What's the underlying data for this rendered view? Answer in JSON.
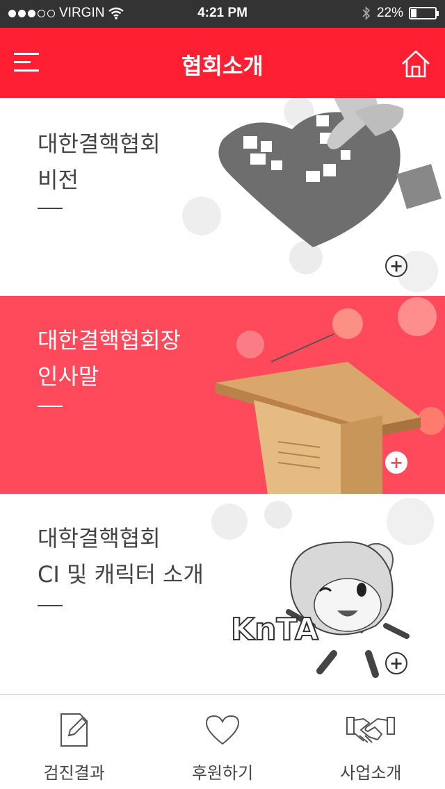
{
  "status_bar": {
    "carrier": "VIRGIN",
    "time": "4:21 PM",
    "battery": "22%",
    "battery_level": 0.22
  },
  "header": {
    "title": "협회소개",
    "menu_icon": "hamburger-menu-icon",
    "home_icon": "home-icon"
  },
  "cards": [
    {
      "line1": "대한결핵협회",
      "line2": "비전",
      "image": "heart-puzzle-image"
    },
    {
      "line1": "대한결핵협회장",
      "line2": "인사말",
      "image": "podium-image"
    },
    {
      "line1": "대학결핵협회",
      "line2": "CI 및 캐릭터 소개",
      "image": "knta-character-image",
      "logo_text": "KnTA"
    }
  ],
  "tabs": [
    {
      "label": "검진결과",
      "icon": "edit-document-icon"
    },
    {
      "label": "후원하기",
      "icon": "heart-icon"
    },
    {
      "label": "사업소개",
      "icon": "handshake-icon"
    }
  ],
  "colors": {
    "brand_red": "#ff1f33",
    "card_red": "#ff4a5c",
    "status_bg": "#333333"
  }
}
